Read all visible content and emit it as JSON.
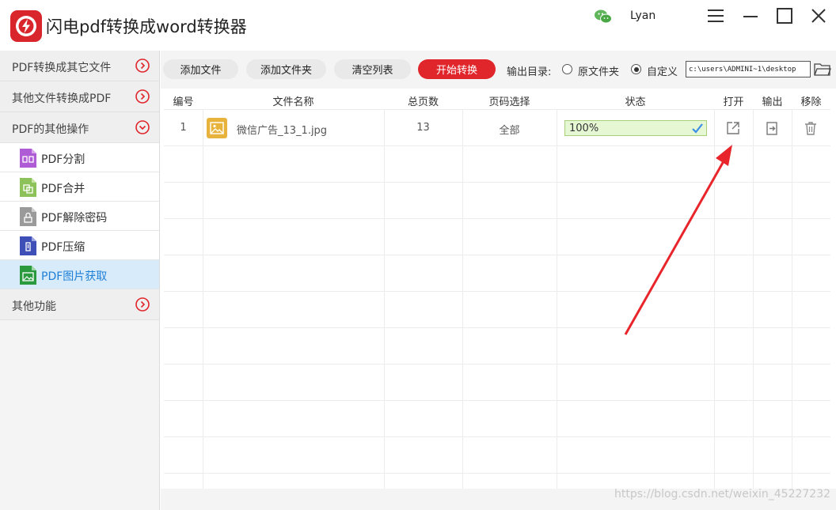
{
  "app": {
    "title": "闪电pdf转换成word转换器",
    "user": "Lyan",
    "accent_color": "#e0252b"
  },
  "sidebar": {
    "categories": [
      {
        "label": "PDF转换成其它文件",
        "state": "collapsed"
      },
      {
        "label": "其他文件转换成PDF",
        "state": "collapsed"
      },
      {
        "label": "PDF的其他操作",
        "state": "expanded"
      },
      {
        "label": "其他功能",
        "state": "collapsed"
      }
    ],
    "items": [
      {
        "label": "PDF分割",
        "icon": "pdf-split-icon",
        "color": "#b05bd6"
      },
      {
        "label": "PDF合并",
        "icon": "pdf-merge-icon",
        "color": "#8dc15a"
      },
      {
        "label": "PDF解除密码",
        "icon": "pdf-unlock-icon",
        "color": "#9a9a9a"
      },
      {
        "label": "PDF压缩",
        "icon": "pdf-compress-icon",
        "color": "#3e4fb8"
      },
      {
        "label": "PDF图片获取",
        "icon": "pdf-image-extract-icon",
        "color": "#2b9a3e",
        "active": true
      }
    ]
  },
  "toolbar": {
    "add_file": "添加文件",
    "add_folder": "添加文件夹",
    "clear_list": "清空列表",
    "start_convert": "开始转换",
    "output_dir_label": "输出目录:",
    "option_original": "原文件夹",
    "option_custom": "自定义",
    "selected_option": "自定义",
    "output_path": "c:\\users\\ADMINI~1\\desktop"
  },
  "table": {
    "headers": [
      "编号",
      "文件名称",
      "总页数",
      "页码选择",
      "状态",
      "打开",
      "输出",
      "移除"
    ],
    "rows": [
      {
        "index": "1",
        "filename": "微信广告_13_1.jpg",
        "pages": "13",
        "page_range": "全部",
        "status": "100%",
        "progress": 1.0
      }
    ]
  },
  "watermark": "https://blog.csdn.net/weixin_45227232"
}
